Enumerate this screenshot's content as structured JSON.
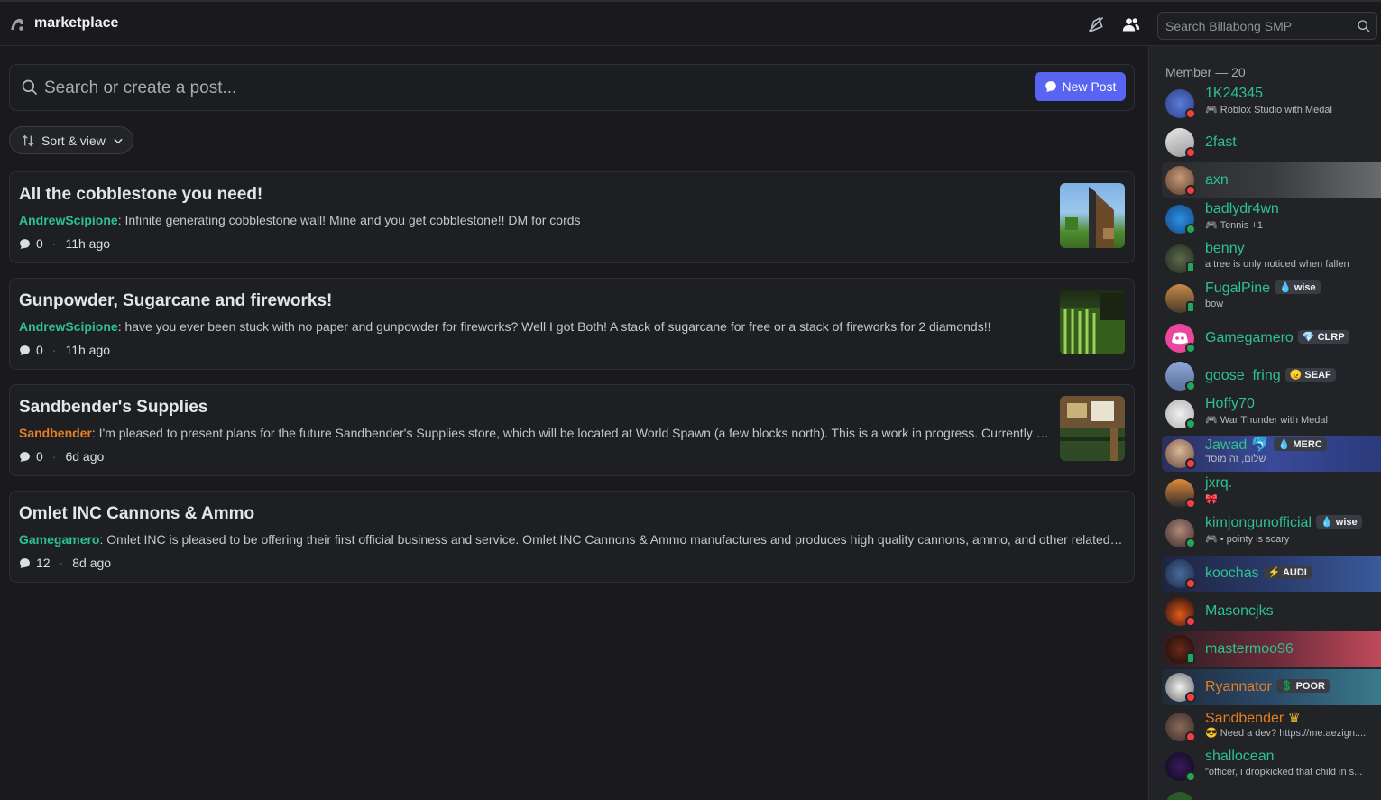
{
  "header": {
    "channel_name": "marketplace",
    "search_placeholder": "Search Billabong SMP"
  },
  "forum": {
    "search_placeholder": "Search or create a post...",
    "new_post_label": "New Post",
    "sort_label": "Sort & view",
    "posts": [
      {
        "title": "All the cobblestone you need!",
        "author": "AndrewScipione",
        "snippet": " Infinite generating cobblestone wall! Mine and you get cobblestone!! DM for cords",
        "comments": "0",
        "age": "11h ago"
      },
      {
        "title": "Gunpowder, Sugarcane and fireworks!",
        "author": "AndrewScipione",
        "snippet": " have you ever been stuck with no paper and gunpowder for fireworks? Well I got Both! A stack of sugarcane for free or a stack of fireworks for 2 diamonds!!",
        "comments": "0",
        "age": "11h ago"
      },
      {
        "title": "Sandbender's Supplies",
        "author": "Sandbender",
        "snippet": " I'm pleased to present plans for the future Sandbender's Supplies store, which will be located at World Spawn (a few blocks north). This is a work in progress. Currently there ar...",
        "comments": "0",
        "age": "6d ago"
      },
      {
        "title": "Omlet INC Cannons & Ammo",
        "author": "Gamegamero",
        "snippet": " Omlet INC is pleased to be offering their first official business and service. Omlet INC Cannons & Ammo manufactures and produces high quality cannons, ammo, and other related parts. T...",
        "comments": "12",
        "age": "8d ago"
      }
    ]
  },
  "members": {
    "header": "Member — 20",
    "list": [
      {
        "name": "1K24345",
        "status": "Roblox Studio with Medal",
        "tag": ""
      },
      {
        "name": "2fast",
        "status": "",
        "tag": ""
      },
      {
        "name": "axn",
        "status": "",
        "tag": ""
      },
      {
        "name": "badlydr4wn",
        "status": "Tennis +1",
        "tag": ""
      },
      {
        "name": "benny",
        "status": "a tree is only noticed when fallen",
        "tag": ""
      },
      {
        "name": "FugalPine",
        "status": "bow",
        "tag": "wise"
      },
      {
        "name": "Gamegamero",
        "status": "",
        "tag": "CLRP"
      },
      {
        "name": "goose_fring",
        "status": "",
        "tag": "SEAF"
      },
      {
        "name": "Hoffy70",
        "status": "War Thunder with Medal",
        "tag": ""
      },
      {
        "name": "Jawad",
        "status": "שלום, זה מוסד",
        "tag": "MERC"
      },
      {
        "name": "jxrq.",
        "status": "",
        "tag": ""
      },
      {
        "name": "kimjongunofficial",
        "status": "• pointy is scary",
        "tag": "wise"
      },
      {
        "name": "koochas",
        "status": "",
        "tag": "AUDI"
      },
      {
        "name": "Masoncjks",
        "status": "",
        "tag": ""
      },
      {
        "name": "mastermoo96",
        "status": "",
        "tag": ""
      },
      {
        "name": "Ryannator",
        "status": "",
        "tag": "POOR"
      },
      {
        "name": "Sandbender",
        "status": "Need a dev? https://me.aezign....",
        "tag": ""
      },
      {
        "name": "shallocean",
        "status": "\"officer, i dropkicked that child in s...",
        "tag": ""
      }
    ]
  },
  "colors": {
    "accent": "#5865f2",
    "member_green": "#2dc28c",
    "member_orange": "#e67e22"
  }
}
